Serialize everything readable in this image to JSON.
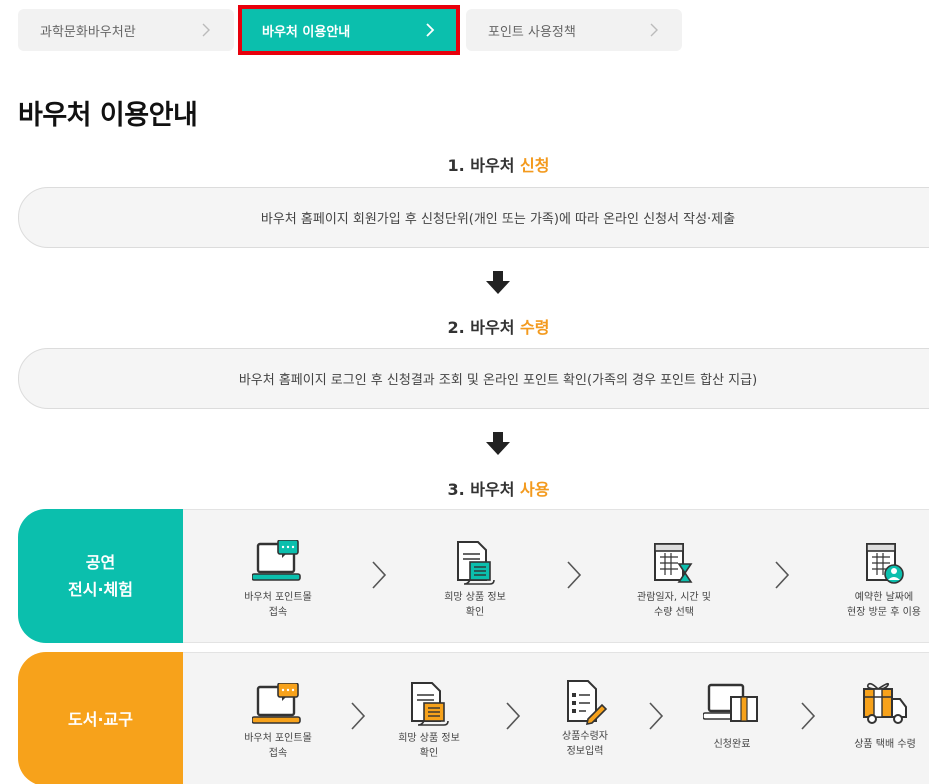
{
  "tabs": [
    {
      "label": "과학문화바우처란",
      "active": false
    },
    {
      "label": "바우처 이용안내",
      "active": true
    },
    {
      "label": "포인트 사용정책",
      "active": false
    }
  ],
  "page_title": "바우처 이용안내",
  "steps": [
    {
      "prefix": "1. 바우처 ",
      "highlight": "신청",
      "description": "바우처 홈페이지 회원가입 후 신청단위(개인 또는 가족)에 따라 온라인 신청서 작성·제출"
    },
    {
      "prefix": "2. 바우처 ",
      "highlight": "수령",
      "description": "바우처 홈페이지 로그인 후 신청결과 조회 및 온라인 포인트 확인(가족의 경우 포인트 합산 지급)"
    },
    {
      "prefix": "3. 바우처 ",
      "highlight": "사용"
    }
  ],
  "usage": [
    {
      "category_line1": "공연",
      "category_line2": "전시·체험",
      "color": "#0bbfad",
      "items": [
        {
          "icon": "laptop-chat-icon",
          "line1": "바우처 포인트몰",
          "line2": "접속"
        },
        {
          "icon": "document-list-icon",
          "line1": "희망 상품 정보",
          "line2": "확인"
        },
        {
          "icon": "calendar-hourglass-icon",
          "line1": "관람일자, 시간 및",
          "line2": "수량 선택"
        },
        {
          "icon": "calendar-person-icon",
          "line1": "예약한 날짜에",
          "line2": "현장 방문 후 이용"
        }
      ]
    },
    {
      "category_line1": "도서·교구",
      "category_line2": "",
      "color": "#f7a21b",
      "items": [
        {
          "icon": "laptop-chat-icon",
          "line1": "바우처 포인트몰",
          "line2": "접속"
        },
        {
          "icon": "document-list-icon",
          "line1": "희망 상품 정보",
          "line2": "확인"
        },
        {
          "icon": "form-pencil-icon",
          "line1": "상품수령자",
          "line2": "정보입력"
        },
        {
          "icon": "laptop-box-icon",
          "line1": "신청완료",
          "line2": ""
        },
        {
          "icon": "delivery-truck-icon",
          "line1": "상품 택배 수령",
          "line2": ""
        }
      ]
    }
  ]
}
